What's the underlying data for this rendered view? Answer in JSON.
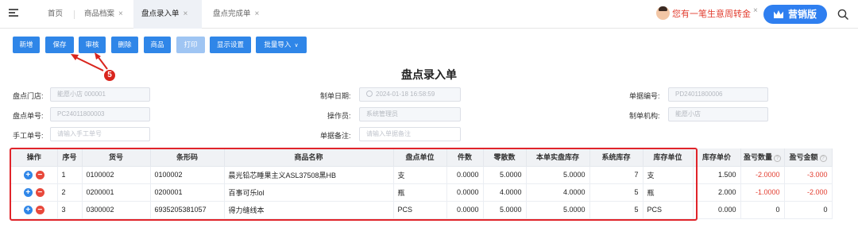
{
  "tabs": [
    {
      "label": "首页",
      "closable": false
    },
    {
      "label": "商品档案",
      "closable": true
    },
    {
      "label": "盘点录入单",
      "closable": true,
      "active": true
    },
    {
      "label": "盘点完成单",
      "closable": true
    }
  ],
  "promo": {
    "text": "您有一笔生意周转金",
    "close": "×"
  },
  "edition": {
    "label": "营销版"
  },
  "toolbar": {
    "new": "新增",
    "save": "保存",
    "audit": "审核",
    "delete": "删除",
    "goods": "商品",
    "print": "打印",
    "display": "显示设置",
    "batch_import": "批量导入"
  },
  "annotation": {
    "step": "5"
  },
  "page_title": "盘点录入单",
  "form": {
    "store": {
      "label": "盘点门店:",
      "value": "能愿小店 000001"
    },
    "order_date": {
      "label": "制单日期:",
      "value": "2024-01-18 16:58:59"
    },
    "order_no": {
      "label": "单据编号:",
      "value": "PD24011800006"
    },
    "check_no": {
      "label": "盘点单号:",
      "value": "PC24011800003"
    },
    "operator": {
      "label": "操作员:",
      "value": "系统管理员"
    },
    "org": {
      "label": "制单机构:",
      "value": "能愿小店"
    },
    "manual_no": {
      "label": "手工单号:",
      "placeholder": "请输入手工单号"
    },
    "remark": {
      "label": "单据备注:",
      "placeholder": "请输入单据备注"
    }
  },
  "table": {
    "headers": [
      "操作",
      "序号",
      "货号",
      "条形码",
      "商品名称",
      "盘点单位",
      "件数",
      "零散数",
      "本单实盘库存",
      "系统库存",
      "库存单位",
      "库存单价",
      "盈亏数量",
      "盈亏金额"
    ],
    "rows": [
      {
        "seq": "1",
        "code": "0100002",
        "barcode": "0100002",
        "name": "晨光铅芯睡果主义ASL37508黑HB",
        "unit": "支",
        "pieces": "0.0000",
        "loose": "5.0000",
        "actual": "5.0000",
        "system": "7",
        "stock_unit": "支",
        "price": "1.500",
        "diff_qty": "-2.0000",
        "diff_amt": "-3.000"
      },
      {
        "seq": "2",
        "code": "0200001",
        "barcode": "0200001",
        "name": "百事可乐lol",
        "unit": "瓶",
        "pieces": "0.0000",
        "loose": "4.0000",
        "actual": "4.0000",
        "system": "5",
        "stock_unit": "瓶",
        "price": "2.000",
        "diff_qty": "-1.0000",
        "diff_amt": "-2.000"
      },
      {
        "seq": "3",
        "code": "0300002",
        "barcode": "6935205381057",
        "name": "得力缝线本",
        "unit": "PCS",
        "pieces": "0.0000",
        "loose": "5.0000",
        "actual": "5.0000",
        "system": "5",
        "stock_unit": "PCS",
        "price": "0.000",
        "diff_qty": "0",
        "diff_amt": "0"
      }
    ]
  },
  "icons": {
    "menu": "menu-icon",
    "search": "search-icon",
    "add": "plus-icon",
    "remove": "minus-icon",
    "help": "question-icon"
  },
  "colors": {
    "primary": "#2f86e8",
    "danger": "#e8483b",
    "highlight": "#e0242a",
    "negative": "#e23d2f"
  }
}
